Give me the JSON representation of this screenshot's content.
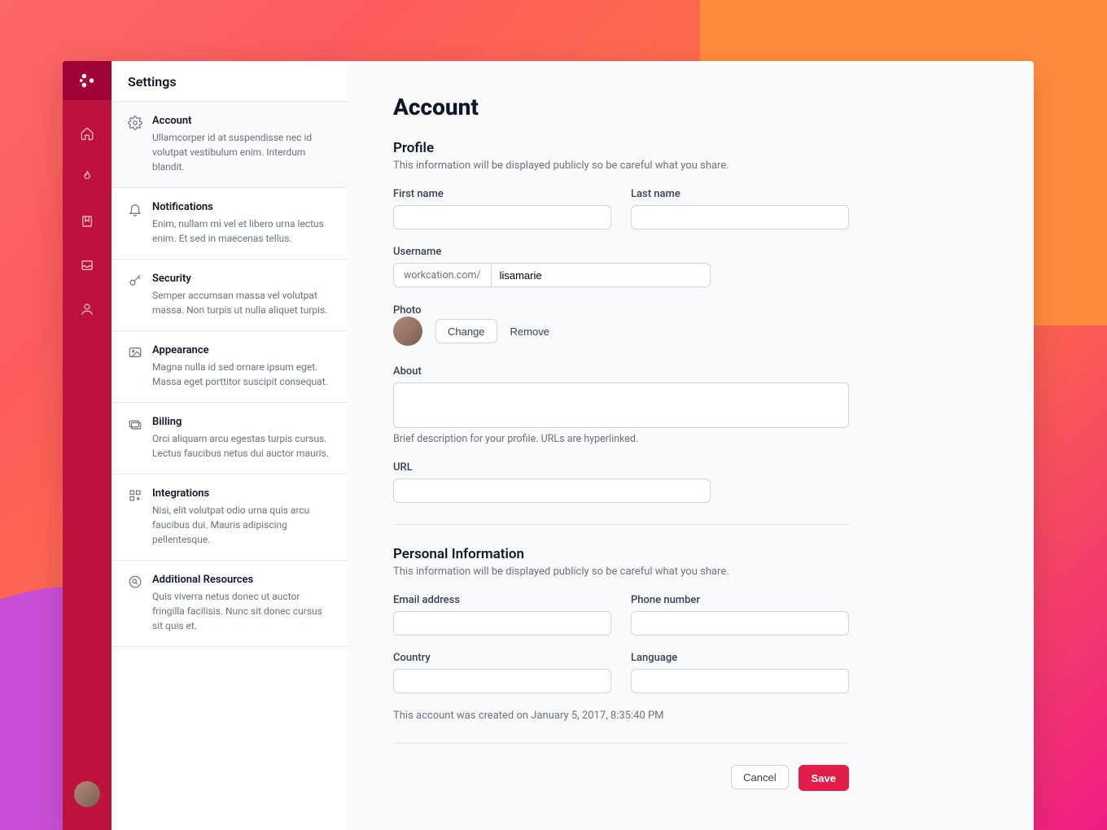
{
  "colors": {
    "accent": "#e11d48",
    "rail": "#be123c",
    "rail_dark": "#9f0337"
  },
  "panel": {
    "title": "Settings",
    "items": [
      {
        "title": "Account",
        "desc": "Ullamcorper id at suspendisse nec id volutpat vestibulum enim. Interdum blandit.",
        "active": true
      },
      {
        "title": "Notifications",
        "desc": "Enim, nullam mi vel et libero urna lectus enim. Et sed in maecenas tellus."
      },
      {
        "title": "Security",
        "desc": "Semper accumsan massa vel volutpat massa. Non turpis ut nulla aliquet turpis."
      },
      {
        "title": "Appearance",
        "desc": "Magna nulla id sed ornare ipsum eget. Massa eget porttitor suscipit consequat."
      },
      {
        "title": "Billing",
        "desc": "Orci aliquam arcu egestas turpis cursus. Lectus faucibus netus dui auctor mauris."
      },
      {
        "title": "Integrations",
        "desc": "Nisi, elit volutpat odio urna quis arcu faucibus dui. Mauris adipiscing pellentesque."
      },
      {
        "title": "Additional Resources",
        "desc": "Quis viverra netus donec ut auctor fringilla facilisis. Nunc sit donec cursus sit quis et."
      }
    ]
  },
  "main": {
    "heading": "Account",
    "profile": {
      "title": "Profile",
      "desc": "This information will be displayed publicly so be careful what you share.",
      "first_name_label": "First name",
      "first_name_value": "",
      "last_name_label": "Last name",
      "last_name_value": "",
      "username_label": "Username",
      "username_prefix": "workcation.com/",
      "username_value": "lisamarie",
      "photo_label": "Photo",
      "change_label": "Change",
      "remove_label": "Remove",
      "about_label": "About",
      "about_value": "",
      "about_hint": "Brief description for your profile. URLs are hyperlinked.",
      "url_label": "URL",
      "url_value": ""
    },
    "personal": {
      "title": "Personal Information",
      "desc": "This information will be displayed publicly so be careful what you share.",
      "email_label": "Email address",
      "email_value": "",
      "phone_label": "Phone number",
      "phone_value": "",
      "country_label": "Country",
      "country_value": "",
      "language_label": "Language",
      "language_value": "",
      "created_meta": "This account was created on January 5, 2017, 8:35:40 PM"
    },
    "actions": {
      "cancel": "Cancel",
      "save": "Save"
    }
  }
}
